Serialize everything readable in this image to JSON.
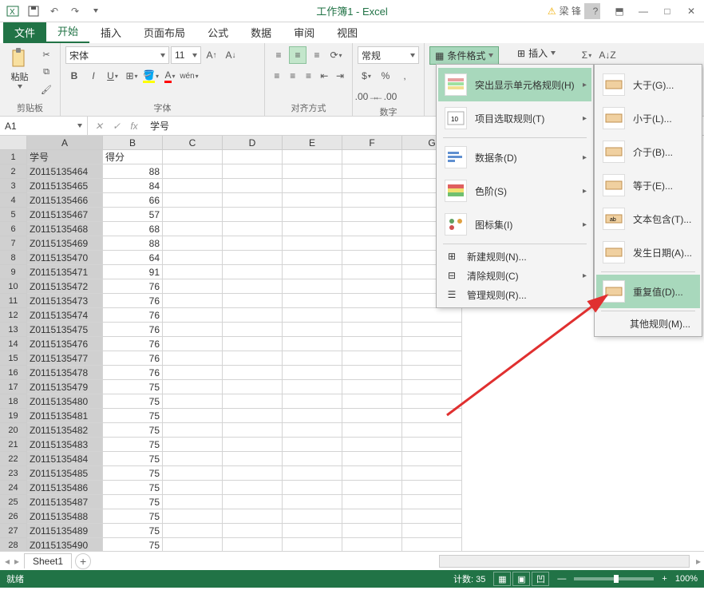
{
  "title": "工作簿1 - Excel",
  "user": {
    "name": "梁 锋"
  },
  "tabs": {
    "file": "文件",
    "home": "开始",
    "insert": "插入",
    "layout": "页面布局",
    "formula": "公式",
    "data": "数据",
    "review": "审阅",
    "view": "视图"
  },
  "ribbon": {
    "clipboard": {
      "label": "剪贴板",
      "paste": "粘贴"
    },
    "font": {
      "label": "字体",
      "name": "宋体",
      "size": "11",
      "bold": "B",
      "italic": "I",
      "underline": "U"
    },
    "alignment": {
      "label": "对齐方式"
    },
    "number": {
      "label": "数字",
      "format": "常规"
    },
    "cf": {
      "label": "条件格式"
    },
    "insert_btn": "插入"
  },
  "namebox": "A1",
  "formula_value": "学号",
  "columns": [
    "A",
    "B",
    "C",
    "D",
    "E",
    "F",
    "G"
  ],
  "rows_visible": 28,
  "headers": {
    "col_a": "学号",
    "col_b": "得分"
  },
  "grid": [
    {
      "id": "Z0115135464",
      "score": 88
    },
    {
      "id": "Z0115135465",
      "score": 84
    },
    {
      "id": "Z0115135466",
      "score": 66
    },
    {
      "id": "Z0115135467",
      "score": 57
    },
    {
      "id": "Z0115135468",
      "score": 68
    },
    {
      "id": "Z0115135469",
      "score": 88
    },
    {
      "id": "Z0115135470",
      "score": 64
    },
    {
      "id": "Z0115135471",
      "score": 91
    },
    {
      "id": "Z0115135472",
      "score": 76
    },
    {
      "id": "Z0115135473",
      "score": 76
    },
    {
      "id": "Z0115135474",
      "score": 76
    },
    {
      "id": "Z0115135475",
      "score": 76
    },
    {
      "id": "Z0115135476",
      "score": 76
    },
    {
      "id": "Z0115135477",
      "score": 76
    },
    {
      "id": "Z0115135478",
      "score": 76
    },
    {
      "id": "Z0115135479",
      "score": 75
    },
    {
      "id": "Z0115135480",
      "score": 75
    },
    {
      "id": "Z0115135481",
      "score": 75
    },
    {
      "id": "Z0115135482",
      "score": 75
    },
    {
      "id": "Z0115135483",
      "score": 75
    },
    {
      "id": "Z0115135484",
      "score": 75
    },
    {
      "id": "Z0115135485",
      "score": 75
    },
    {
      "id": "Z0115135486",
      "score": 75
    },
    {
      "id": "Z0115135487",
      "score": 75
    },
    {
      "id": "Z0115135488",
      "score": 75
    },
    {
      "id": "Z0115135489",
      "score": 75
    },
    {
      "id": "Z0115135490",
      "score": 75
    }
  ],
  "selection": {
    "ref": "A1:A35"
  },
  "sheet": {
    "name": "Sheet1"
  },
  "status": {
    "ready": "就绪",
    "count_label": "计数:",
    "count": "35",
    "zoom": "100%"
  },
  "menu1": {
    "highlight": "突出显示单元格规则(H)",
    "top": "项目选取规则(T)",
    "databars": "数据条(D)",
    "colorscales": "色阶(S)",
    "iconsets": "图标集(I)",
    "new": "新建规则(N)...",
    "clear": "清除规则(C)",
    "manage": "管理规则(R)..."
  },
  "menu2": {
    "greater": "大于(G)...",
    "less": "小于(L)...",
    "between": "介于(B)...",
    "equal": "等于(E)...",
    "textcontains": "文本包含(T)...",
    "date": "发生日期(A)...",
    "duplicate": "重复值(D)...",
    "other": "其他规则(M)..."
  }
}
